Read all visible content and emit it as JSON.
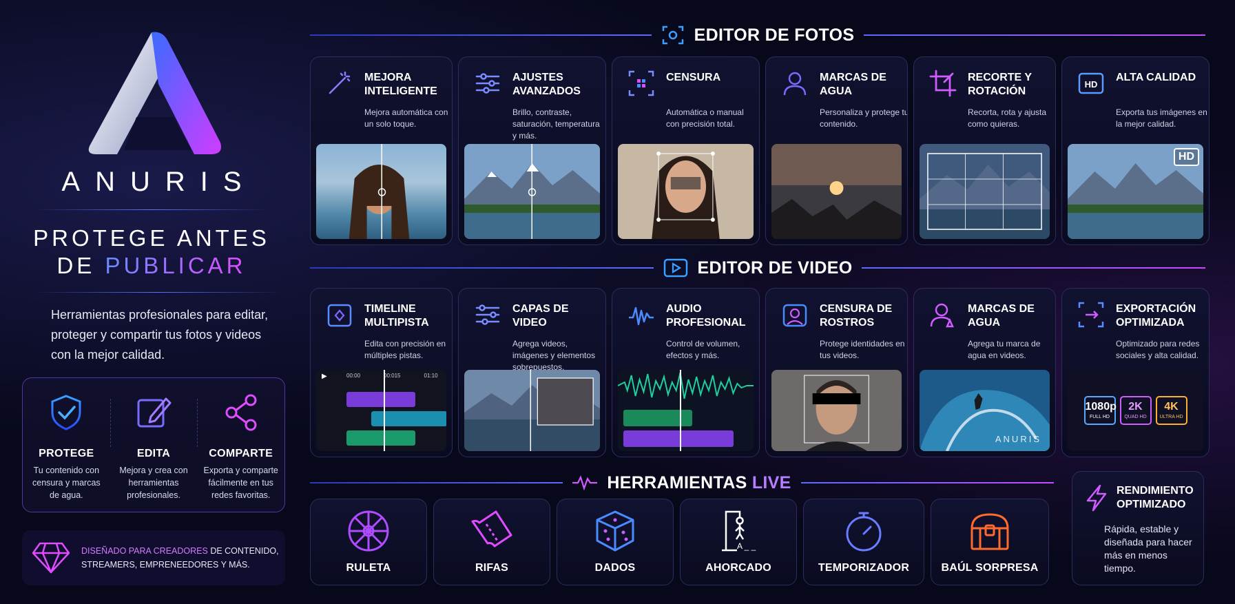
{
  "brand": {
    "name": "ANURIS",
    "tagline_line1": "PROTEGE ANTES",
    "tagline_prefix": "DE ",
    "tagline_highlight": "PUBLICAR",
    "description": "Herramientas profesionales para editar, proteger y compartir tus fotos y videos con la mejor calidad."
  },
  "features": [
    {
      "title": "PROTEGE",
      "text": "Tu contenido con censura y marcas de agua.",
      "icon": "shield-check-icon"
    },
    {
      "title": "EDITA",
      "text": "Mejora y crea con herramientas profesionales.",
      "icon": "edit-pencil-icon"
    },
    {
      "title": "COMPARTE",
      "text": "Exporta y comparte fácilmente en tus redes favoritas.",
      "icon": "share-icon"
    }
  ],
  "creators": {
    "highlight": "DISEÑADO PARA CREADORES",
    "text": " DE CONTENIDO, STREAMERS, EMPRENEEDORES Y MÁS."
  },
  "photo_editor": {
    "title": "EDITOR DE FOTOS",
    "cards": [
      {
        "title": "MEJORA INTELIGENTE",
        "text": "Mejora automática con un solo toque.",
        "icon": "magic-wand-icon"
      },
      {
        "title": "AJUSTES AVANZADOS",
        "text": "Brillo, contraste, saturación, temperatura y más.",
        "icon": "sliders-icon"
      },
      {
        "title": "CENSURA",
        "text": "Automática o manual con precisión total.",
        "icon": "blur-face-icon"
      },
      {
        "title": "MARCAS DE AGUA",
        "text": "Personaliza y protege tu contenido.",
        "icon": "user-watermark-icon"
      },
      {
        "title": "RECORTE Y ROTACIÓN",
        "text": "Recorta, rota y ajusta como quieras.",
        "icon": "crop-icon"
      },
      {
        "title": "ALTA CALIDAD",
        "text": "Exporta tus imágenes en la mejor calidad.",
        "icon": "hd-icon",
        "badge": "HD"
      }
    ]
  },
  "video_editor": {
    "title": "EDITOR DE VIDEO",
    "cards": [
      {
        "title": "TIMELINE MULTIPISTA",
        "text": "Edita con precisión en múltiples pistas.",
        "icon": "timeline-icon",
        "times": [
          "00:00",
          "00:015",
          "01:10"
        ]
      },
      {
        "title": "CAPAS DE VIDEO",
        "text": "Agrega videos, imágenes y elementos sobrepuestos.",
        "icon": "layers-icon"
      },
      {
        "title": "AUDIO PROFESIONAL",
        "text": "Control de volumen, efectos y más.",
        "icon": "audio-wave-icon"
      },
      {
        "title": "CENSURA DE ROSTROS",
        "text": "Protege identidades en tus videos.",
        "icon": "face-censor-icon"
      },
      {
        "title": "MARCAS DE AGUA",
        "text": "Agrega tu marca de agua en videos.",
        "icon": "user-watermark-icon",
        "watermark": "ANURIS"
      },
      {
        "title": "EXPORTACIÓN OPTIMIZADA",
        "text": "Optimizado para redes sociales y alta calidad.",
        "icon": "export-icon",
        "formats": [
          {
            "big": "1080p",
            "small": "FULL HD",
            "color": "#5aa8ff"
          },
          {
            "big": "2K",
            "small": "QUAD HD",
            "color": "#d05cff"
          },
          {
            "big": "4K",
            "small": "ULTRA HD",
            "color": "#ffb02e"
          }
        ]
      }
    ]
  },
  "live_tools": {
    "title_prefix": "HERRAMIENTAS ",
    "title_highlight": "LIVE",
    "items": [
      {
        "label": "RULETA",
        "icon": "roulette-icon"
      },
      {
        "label": "RIFAS",
        "icon": "ticket-icon"
      },
      {
        "label": "DADOS",
        "icon": "dice-icon"
      },
      {
        "label": "AHORCADO",
        "icon": "hangman-icon",
        "hint": "A _ _"
      },
      {
        "label": "TEMPORIZADOR",
        "icon": "stopwatch-icon"
      },
      {
        "label": "BAÚL SORPRESA",
        "icon": "treasure-chest-icon"
      }
    ]
  },
  "performance": {
    "title": "RENDIMIENTO OPTIMIZADO",
    "text": "Rápida, estable y diseñada para hacer más en menos tiempo.",
    "icon": "lightning-icon"
  },
  "colors": {
    "accent_blue": "#4a6bff",
    "accent_purple": "#b04cff",
    "accent_pink": "#e04cff",
    "bg": "#07081a"
  }
}
